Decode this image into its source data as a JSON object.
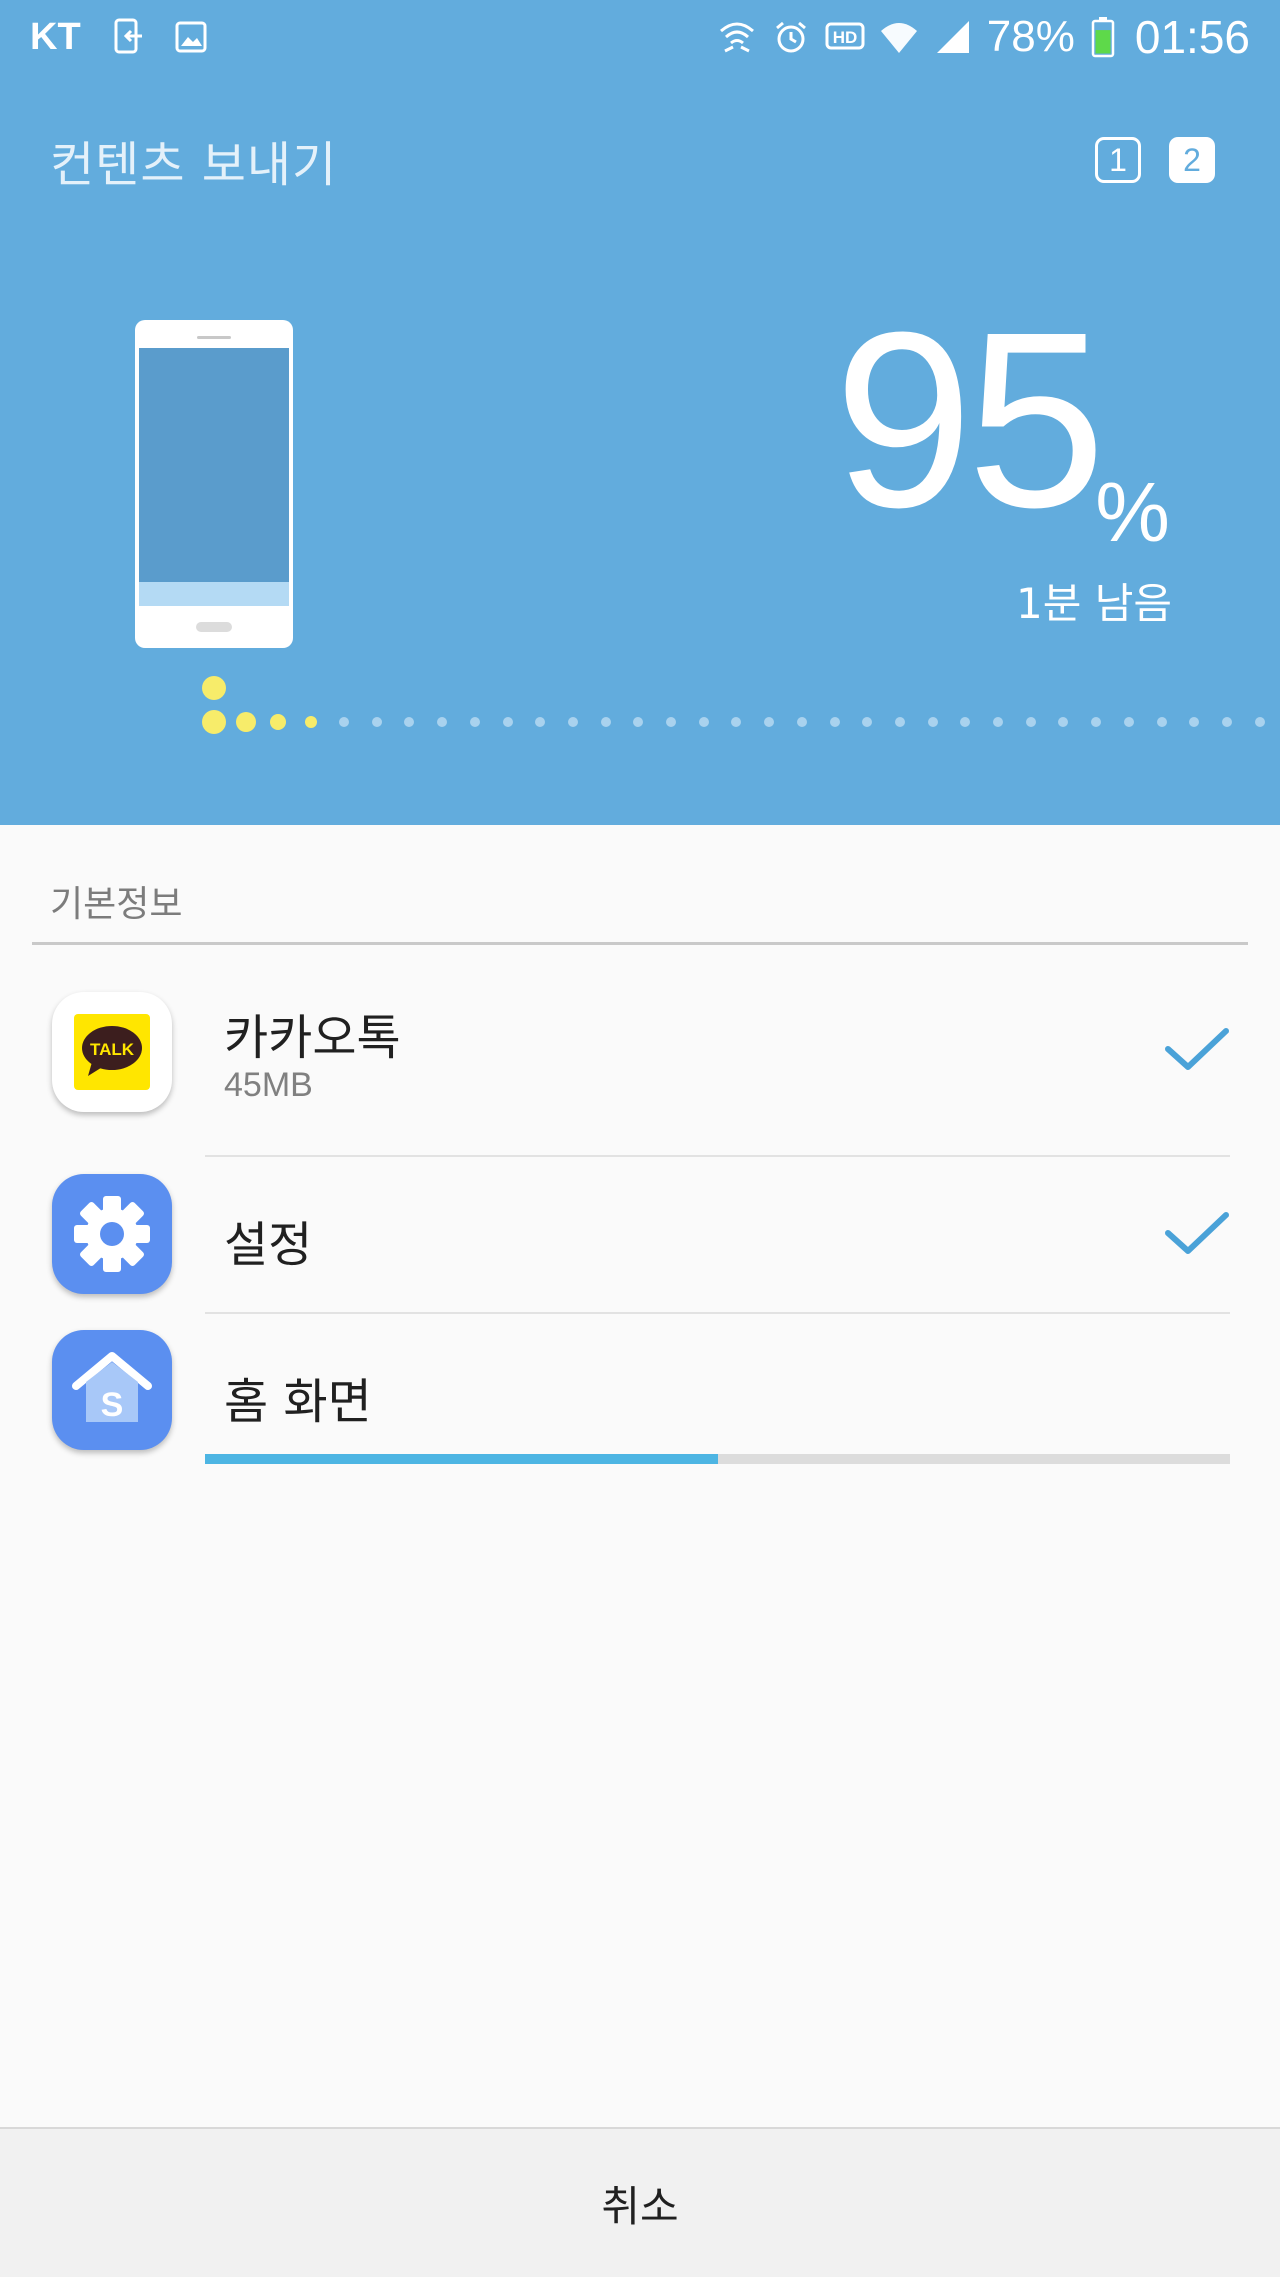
{
  "status_bar": {
    "carrier": "KT",
    "battery_percent": "78%",
    "battery_level": 0.78,
    "time": "01:56",
    "icons_left": [
      "nfc-transfer-icon",
      "gallery-icon"
    ],
    "icons_right": [
      "wifi-calling-icon",
      "alarm-icon",
      "hd-voice-icon",
      "wifi-icon",
      "signal-icon",
      "battery-icon"
    ]
  },
  "header": {
    "title": "컨텐츠 보내기",
    "steps": [
      "1",
      "2"
    ],
    "active_step": "2"
  },
  "transfer": {
    "percent": "95",
    "percent_sign": "%",
    "remaining": "1분 남음",
    "progress_value": 0.95
  },
  "section": {
    "title": "기본정보"
  },
  "items": [
    {
      "title": "카카오톡",
      "size": "45MB",
      "icon": "kakaotalk-icon",
      "done": true,
      "icon_label": "TALK"
    },
    {
      "title": "설정",
      "size": "",
      "icon": "settings-gear-icon",
      "done": true
    },
    {
      "title": "홈 화면",
      "size": "",
      "icon": "home-screen-icon",
      "done": false,
      "icon_label": "S",
      "progress": 0.5
    }
  ],
  "footer": {
    "cancel_label": "취소"
  },
  "colors": {
    "hero_bg": "#62acdd",
    "accent": "#4db5e3",
    "dot_active": "#f7ec6a",
    "dot_inactive": "#a9d2ee",
    "check": "#4aa2d8"
  }
}
